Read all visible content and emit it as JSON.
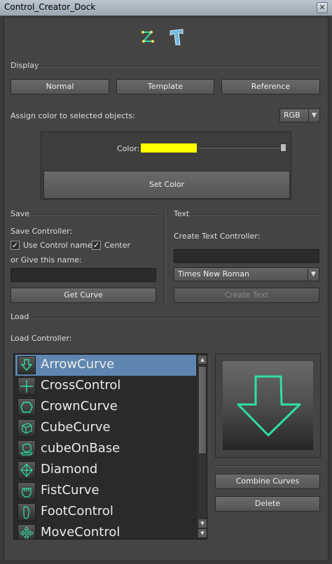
{
  "window": {
    "title": "Control_Creator_Dock",
    "close_glyph": "✕"
  },
  "toolbar": {
    "curve_icon": "curve-tool-icon",
    "text_icon": "text-tool-icon"
  },
  "display": {
    "section_label": "Display",
    "buttons": [
      "Normal",
      "Template",
      "Reference"
    ]
  },
  "color": {
    "assign_label": "Assign color to selected objects:",
    "mode": "RGB",
    "color_label": "Color:",
    "swatch_hex": "#ffff00",
    "slider_value_percent": 100,
    "set_color_label": "Set Color"
  },
  "save": {
    "section_label": "Save",
    "save_controller_label": "Save Controller:",
    "use_control_name_label": "Use Control name",
    "use_control_name_checked": true,
    "center_label": "Center",
    "center_checked": true,
    "give_name_label": "or Give this name:",
    "name_value": "",
    "get_curve_label": "Get Curve"
  },
  "text": {
    "section_label": "Text",
    "create_text_controller_label": "Create Text Controller:",
    "text_value": "",
    "font": "Times New Roman",
    "create_text_label": "Create Text"
  },
  "load": {
    "section_label": "Load",
    "load_controller_label": "Load Controller:",
    "items": [
      {
        "label": "ArrowCurve",
        "icon": "arrow-curve-icon",
        "selected": true
      },
      {
        "label": "CrossControl",
        "icon": "cross-control-icon",
        "selected": false
      },
      {
        "label": "CrownCurve",
        "icon": "crown-curve-icon",
        "selected": false
      },
      {
        "label": "CubeCurve",
        "icon": "cube-curve-icon",
        "selected": false
      },
      {
        "label": "cubeOnBase",
        "icon": "cube-on-base-icon",
        "selected": false
      },
      {
        "label": "Diamond",
        "icon": "diamond-icon",
        "selected": false
      },
      {
        "label": "FistCurve",
        "icon": "fist-curve-icon",
        "selected": false
      },
      {
        "label": "FootControl",
        "icon": "foot-control-icon",
        "selected": false
      },
      {
        "label": "MoveControl",
        "icon": "move-control-icon",
        "selected": false
      }
    ],
    "combine_label": "Combine Curves",
    "delete_label": "Delete",
    "preview_icon": "arrow-down-preview-icon",
    "accent_color": "#2fe0a0"
  }
}
